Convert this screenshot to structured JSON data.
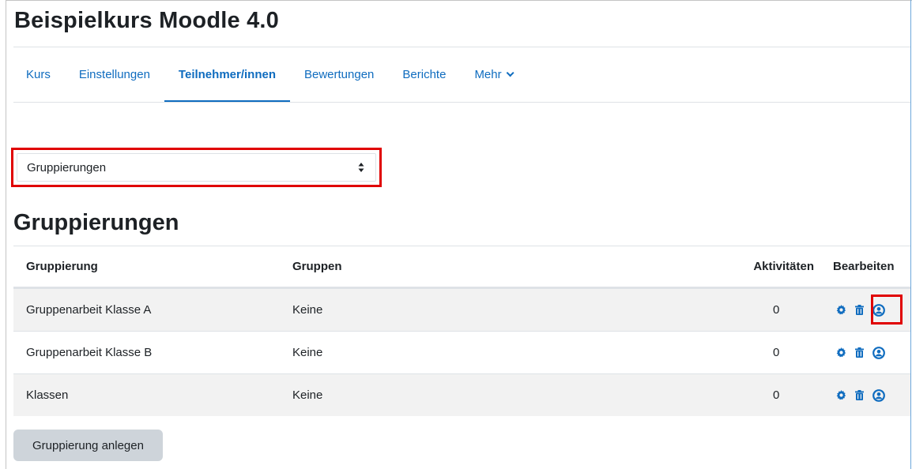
{
  "course": {
    "title": "Beispielkurs Moodle 4.0"
  },
  "nav": {
    "tabs": [
      {
        "label": "Kurs",
        "active": false
      },
      {
        "label": "Einstellungen",
        "active": false
      },
      {
        "label": "Teilnehmer/innen",
        "active": true
      },
      {
        "label": "Bewertungen",
        "active": false
      },
      {
        "label": "Berichte",
        "active": false
      },
      {
        "label": "Mehr",
        "active": false
      }
    ]
  },
  "select": {
    "value": "Gruppierungen"
  },
  "page": {
    "heading": "Gruppierungen"
  },
  "table": {
    "headers": [
      "Gruppierung",
      "Gruppen",
      "Aktivitäten",
      "Bearbeiten"
    ],
    "rows": [
      {
        "name": "Gruppenarbeit Klasse A",
        "groups": "Keine",
        "activities": "0"
      },
      {
        "name": "Gruppenarbeit Klasse B",
        "groups": "Keine",
        "activities": "0"
      },
      {
        "name": "Klassen",
        "groups": "Keine",
        "activities": "0"
      }
    ],
    "action_icons": [
      "gear-icon",
      "trash-icon",
      "user-icon"
    ]
  },
  "buttons": {
    "create": "Gruppierung anlegen"
  },
  "colors": {
    "link": "#0f6cbf",
    "highlight": "#e00000",
    "button_bg": "#ced4da"
  }
}
